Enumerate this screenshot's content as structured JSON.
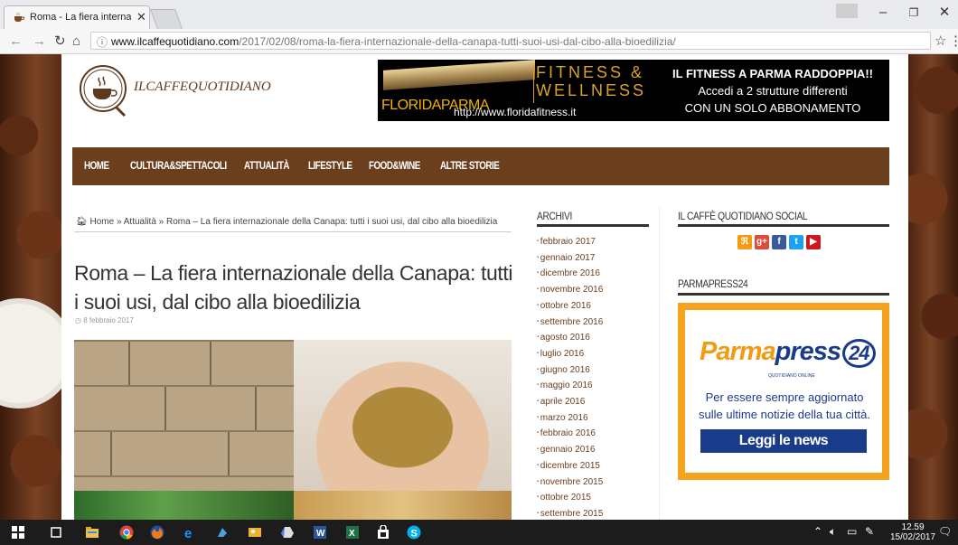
{
  "browser": {
    "tab_title": "Roma - La fiera internazio",
    "url_host": "www.ilcaffequotidiano.com",
    "url_path": "/2017/02/08/roma-la-fiera-internazionale-della-canapa-tutti-suoi-usi-dal-cibo-alla-bioedilizia/"
  },
  "site": {
    "logo_text": "ILCAFFEQUOTIDIANO"
  },
  "banner": {
    "brand": "FLORIDA",
    "brand_city": "PARMA",
    "line1": "FITNESS &",
    "line2": "WELLNESS",
    "url": "http://www.floridafitness.it",
    "promo1": "IL FITNESS A PARMA RADDOPPIA!!",
    "promo2": "Accedi a 2 strutture differenti",
    "promo3": "CON UN SOLO ABBONAMENTO"
  },
  "nav": [
    "HOME",
    "CULTURA&SPETTACOLI",
    "ATTUALITÀ",
    "LIFESTYLE",
    "FOOD&WINE",
    "ALTRE STORIE"
  ],
  "article": {
    "breadcrumb_home": "Home",
    "breadcrumb_sep": "»",
    "breadcrumb_cat": "Attualità",
    "breadcrumb_title": "Roma – La fiera internazionale della Canapa: tutti i suoi usi, dal cibo alla bioedilizia",
    "title": "Roma – La fiera internazionale della Canapa: tutti i suoi usi, dal cibo alla bioedilizia",
    "date": "8 febbraio 2017"
  },
  "archive": {
    "heading": "ARCHIVI",
    "items": [
      "febbraio 2017",
      "gennaio 2017",
      "dicembre 2016",
      "novembre 2016",
      "ottobre 2016",
      "settembre 2016",
      "agosto 2016",
      "luglio 2016",
      "giugno 2016",
      "maggio 2016",
      "aprile 2016",
      "marzo 2016",
      "febbraio 2016",
      "gennaio 2016",
      "dicembre 2015",
      "novembre 2015",
      "ottobre 2015",
      "settembre 2015"
    ]
  },
  "social": {
    "heading": "IL CAFFÈ QUOTIDIANO SOCIAL",
    "icons": [
      "rss-icon",
      "google-plus-icon",
      "facebook-icon",
      "twitter-icon",
      "youtube-icon"
    ]
  },
  "parmapress": {
    "heading": "PARMAPRESS24",
    "logo_a": "Parma",
    "logo_b": "press",
    "logo_num": "24",
    "sub": "QUOTIDIANO ONLINE",
    "text": "Per essere sempre aggiornato sulle ultime notizie della tua città.",
    "button": "Leggi le news"
  },
  "taskbar": {
    "time": "12.59",
    "date": "15/02/2017"
  },
  "colors": {
    "nav_bg": "#6b3f1e",
    "accent_orange": "#f7a21c",
    "pp_blue": "#1a3b8a"
  }
}
